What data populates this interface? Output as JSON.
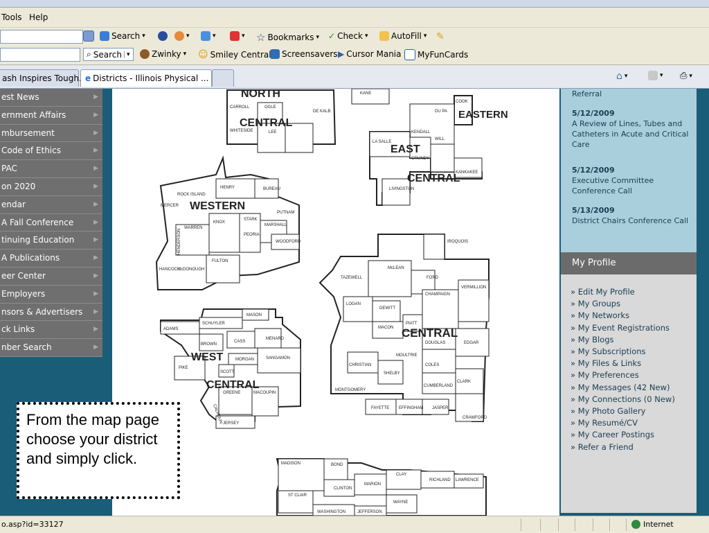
{
  "browser": {
    "menu": {
      "tools": "Tools",
      "help": "Help"
    },
    "toolbar1": {
      "search": "Search",
      "bookmarks": "Bookmarks",
      "check": "Check",
      "autofill": "AutoFill"
    },
    "toolbar2": {
      "search": "Search",
      "zwinky": "Zwinky",
      "smiley": "Smiley Central",
      "screensavers": "Screensavers",
      "cursor": "Cursor Mania",
      "myfuncards": "MyFunCards"
    },
    "tabs": [
      {
        "label": "ash Inspires Tough..."
      },
      {
        "label": "Districts - Illinois Physical ..."
      }
    ],
    "status": {
      "url": "o.asp?id=33127",
      "zone": "Internet"
    }
  },
  "leftnav": {
    "items": [
      {
        "label": "est News"
      },
      {
        "label": "ernment Affairs"
      },
      {
        "label": "mbursement"
      },
      {
        "label": "Code of Ethics"
      },
      {
        "label": "PAC"
      },
      {
        "label": "on 2020"
      },
      {
        "label": "endar"
      },
      {
        "label": "A Fall Conference"
      },
      {
        "label": "tinuing Education"
      },
      {
        "label": "A Publications"
      },
      {
        "label": "eer Center"
      },
      {
        "label": " Employers"
      },
      {
        "label": "nsors & Advertisers"
      },
      {
        "label": "ck Links"
      },
      {
        "label": "nber Search"
      }
    ]
  },
  "events": [
    {
      "date": "",
      "title": "Referral"
    },
    {
      "date": "5/12/2009",
      "title": "A Review of Lines, Tubes and Catheters in Acute and Critical Care"
    },
    {
      "date": "5/12/2009",
      "title": "Executive Committee Conference Call"
    },
    {
      "date": "5/13/2009",
      "title": "District Chairs Conference Call"
    }
  ],
  "profile": {
    "heading": "My Profile",
    "links": [
      "» Edit My Profile",
      "» My Groups",
      "» My Networks",
      "» My Event Registrations",
      "» My Blogs",
      "» My Subscriptions",
      "» My Files & Links",
      "» My Preferences",
      "» My Messages (42 New)",
      "» My Connections (0 New)",
      "» My Photo Gallery",
      "» My Resumé/CV",
      "» My Career Postings",
      "» Refer a Friend"
    ]
  },
  "map": {
    "regions": {
      "north": "NORTH",
      "north_central": "CENTRAL",
      "eastern": "EASTERN",
      "east": "EAST",
      "east_central": "CENTRAL",
      "western": "WESTERN",
      "central": "CENTRAL",
      "west": "WEST",
      "west_central": "CENTRAL"
    },
    "counties": {
      "kane": "KANE",
      "cook": "COOK",
      "dupage": "DU PA",
      "kendall": "KENDALL",
      "will": "WILL",
      "grundy": "GRUNDY",
      "lasalle": "LA SALLE",
      "kankakee": "KANKAKEE",
      "livingston": "LIVINGSTON",
      "carroll": "CARROLL",
      "ogle": "OGLE",
      "dekalb": "DE KALB",
      "whiteside": "WHITESIDE",
      "lee": "LEE",
      "rockisland": "ROCK ISLAND",
      "henry": "HENRY",
      "bureau": "BUREAU",
      "mercer": "MERCER",
      "putnam": "PUTNAM",
      "knox": "KNOX",
      "stark": "STARK",
      "marshall": "MARSHALL",
      "warren": "WARREN",
      "henderson": "HENDERSON",
      "peoria": "PEORIA",
      "woodford": "WOODFORD",
      "fulton": "FULTON",
      "hancock": "HANCOCK",
      "mcdonough": "McDONOUGH",
      "iroquois": "IROQUOIS",
      "tazewell": "TAZEWELL",
      "mclean": "McLEAN",
      "ford": "FORD",
      "vermillion": "VERMILLION",
      "logan": "LOGAN",
      "dewitt": "DEWITT",
      "champaign": "CHAMPAIGN",
      "macon": "MACON",
      "piatt": "PIATT",
      "douglas": "DOUGLAS",
      "edgar": "EDGAR",
      "moultrie": "MOULTRIE",
      "christian": "CHRISTIAN",
      "shelby": "SHELBY",
      "coles": "COLES",
      "montgomery": "MONTGOMERY",
      "cumberland": "CUMBERLAND",
      "clark": "CLARK",
      "fayette": "FAYETTE",
      "effingham": "EFFINGHAM",
      "jasper": "JASPER",
      "crawford": "CRAWFORD",
      "adams": "ADAMS",
      "schuyler": "SCHUYLER",
      "mason": "MASON",
      "brown": "BROWN",
      "cass": "CASS",
      "menard": "MENARD",
      "morgan": "MORGAN",
      "sangamon": "SANGAMON",
      "pike": "PIKE",
      "scott": "SCOTT",
      "greene": "GREENE",
      "macoupin": "MACOUPIN",
      "calhoun": "CALHOUN",
      "jersey": "JERSEY",
      "madison": "MADISON",
      "bond": "BOND",
      "marion": "MARION",
      "clinton": "CLINTON",
      "clay": "CLAY",
      "richland": "RICHLAND",
      "lawrence": "LAWRENCE",
      "stclair": "ST CLAIR",
      "wayne": "WAYNE",
      "washington": "WASHINGTON",
      "jefferson": "JEFFERSON"
    }
  },
  "callout": {
    "text": "From the map page choose your district and simply click."
  },
  "colors": {
    "teal": "#1a5d78",
    "nav_gray": "#6f6f6f",
    "light_blue": "#a9cfdc",
    "profile_gray": "#d9d9d9"
  }
}
